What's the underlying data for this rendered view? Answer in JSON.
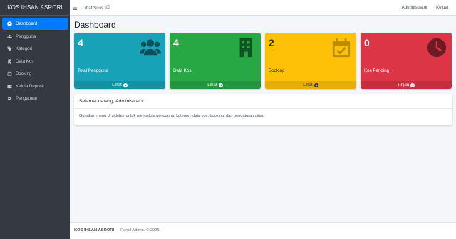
{
  "brand": "KOS IHSAN ASRORI",
  "sidebar": {
    "items": [
      {
        "label": "Dashboard",
        "icon": "dashboard-icon"
      },
      {
        "label": "Pengguna",
        "icon": "users-icon"
      },
      {
        "label": "Kategori",
        "icon": "tags-icon"
      },
      {
        "label": "Data Kos",
        "icon": "building-icon"
      },
      {
        "label": "Booking",
        "icon": "calendar-icon"
      },
      {
        "label": "Kelola Deposit",
        "icon": "wallet-icon"
      },
      {
        "label": "Pengaturan",
        "icon": "gear-icon"
      }
    ]
  },
  "topbar": {
    "site_link": "Lihat Situs",
    "user": "Administrator",
    "logout": "Keluar"
  },
  "page": {
    "title": "Dashboard"
  },
  "stats": [
    {
      "value": "4",
      "label": "Total Pengguna",
      "link": "Lihat",
      "color": "#17a2b8",
      "icon": "users-icon"
    },
    {
      "value": "4",
      "label": "Data Kos",
      "link": "Lihat",
      "color": "#28a745",
      "icon": "building-icon"
    },
    {
      "value": "2",
      "label": "Booking",
      "link": "Lihat",
      "color": "#ffc107",
      "icon": "calendar-check-icon"
    },
    {
      "value": "0",
      "label": "Kos Pending",
      "link": "Tinjau",
      "color": "#dc3545",
      "icon": "clock-icon"
    }
  ],
  "welcome": {
    "title": "Selamat datang, Administrator",
    "text": "Gunakan menu di sidebar untuk mengelola pengguna, kategori, data kos, booking, dan pengaturan situs."
  },
  "footer": {
    "brand": "KOS IHSAN ASRORI",
    "text": " — Panel Admin. © 2026."
  }
}
